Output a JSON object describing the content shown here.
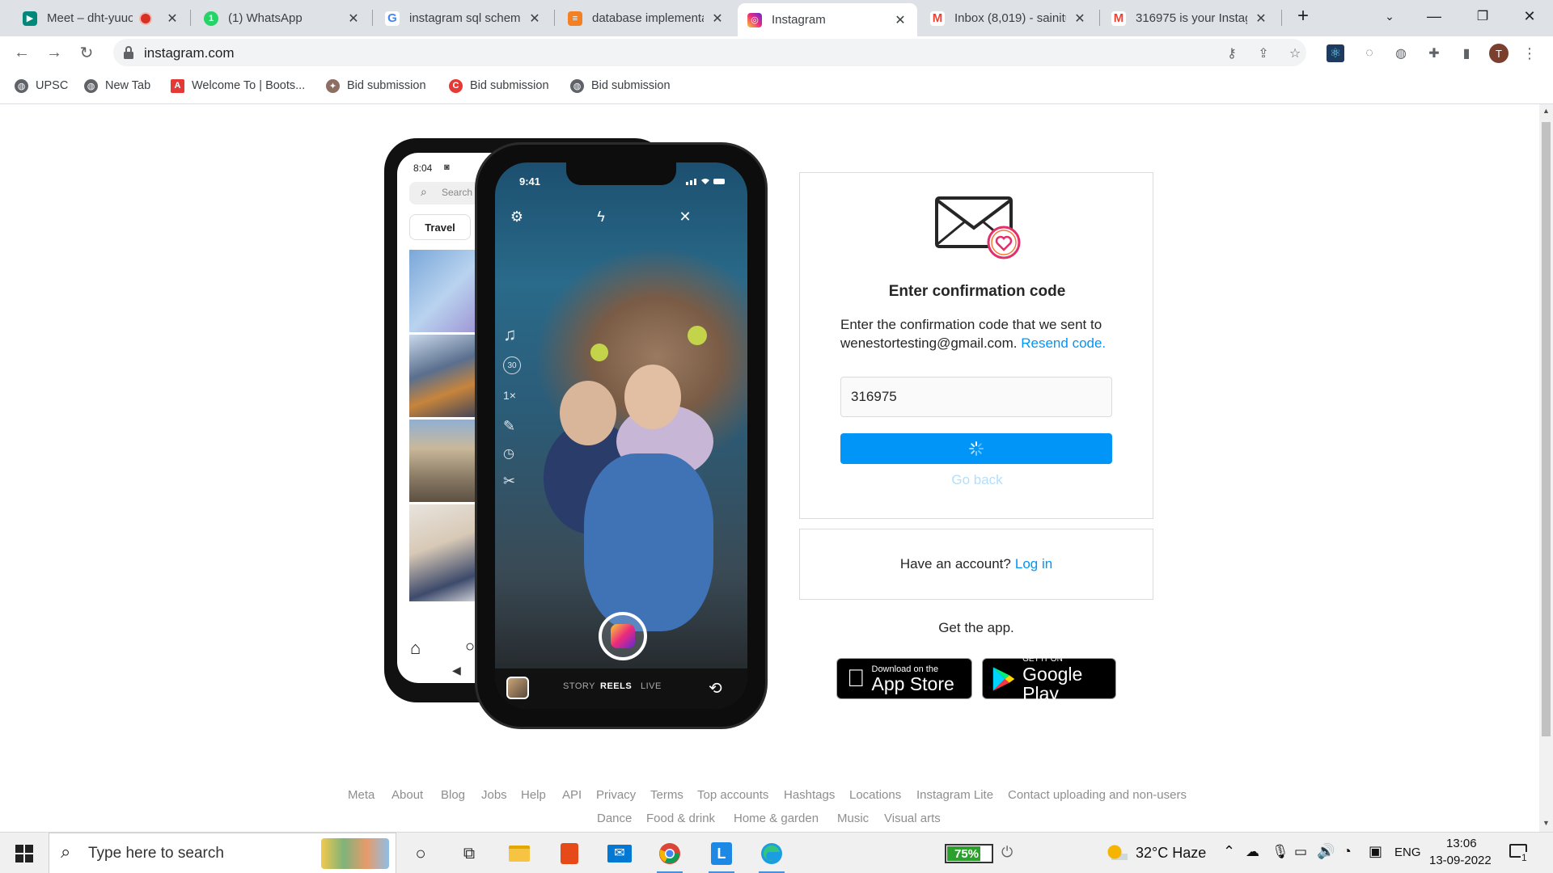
{
  "tabs": [
    {
      "title": "Meet – dht-yuuo",
      "recording": true,
      "favicon": "google-meet-icon",
      "color": "#00897b"
    },
    {
      "title": "(1) WhatsApp",
      "favicon": "whatsapp-icon",
      "color": "#25d366"
    },
    {
      "title": "instagram sql schema",
      "favicon": "google-icon",
      "color": "#4285f4"
    },
    {
      "title": "database implementa",
      "favicon": "stackoverflow-icon",
      "color": "#f48024"
    },
    {
      "title": "Instagram",
      "favicon": "instagram-icon",
      "color": "#e1306c",
      "active": true
    },
    {
      "title": "Inbox (8,019) - sainitu",
      "favicon": "gmail-icon",
      "color": "#ea4335"
    },
    {
      "title": "316975 is your Instag",
      "favicon": "gmail-icon",
      "color": "#ea4335"
    }
  ],
  "address_bar": {
    "url": "instagram.com"
  },
  "bookmarks": [
    {
      "label": "UPSC",
      "icon": "globe-icon",
      "color": "#5f6368"
    },
    {
      "label": "New Tab",
      "icon": "globe-icon",
      "color": "#5f6368"
    },
    {
      "label": "Welcome To | Boots...",
      "icon": "adobe-icon",
      "color": "#e53935"
    },
    {
      "label": "Bid submission",
      "icon": "emblem-icon",
      "color": "#8d6e63"
    },
    {
      "label": "Bid submission",
      "icon": "swirl-icon",
      "color": "#e53935"
    },
    {
      "label": "Bid submission",
      "icon": "globe-icon",
      "color": "#5f6368"
    }
  ],
  "phones": {
    "back_time": "8:04",
    "back_search": "Search",
    "back_chip": "Travel",
    "front_time": "9:41",
    "modes": [
      "STORY",
      "REELS",
      "LIVE"
    ],
    "side_labels": [
      "30",
      "1×"
    ]
  },
  "confirm": {
    "heading": "Enter confirmation code",
    "desc_prefix": "Enter the confirmation code that we sent to wenestortesting@gmail.com.",
    "resend": "Resend code.",
    "code_value": "316975",
    "go_back": "Go back"
  },
  "login_card": {
    "prompt": "Have an account?",
    "link": "Log in"
  },
  "get_app": "Get the app.",
  "badges": {
    "apple_small": "Download on the",
    "apple_big": "App Store",
    "google_small": "GET IT ON",
    "google_big": "Google Play"
  },
  "footer_row1": [
    "Meta",
    "About",
    "Blog",
    "Jobs",
    "Help",
    "API",
    "Privacy",
    "Terms",
    "Top accounts",
    "Hashtags",
    "Locations",
    "Instagram Lite",
    "Contact uploading and non-users"
  ],
  "footer_row2": [
    "Dance",
    "Food & drink",
    "Home & garden",
    "Music",
    "Visual arts"
  ],
  "taskbar": {
    "search_placeholder": "Type here to search",
    "battery": "75%",
    "weather": "32°C  Haze",
    "lang": "ENG",
    "time": "13:06",
    "date": "13-09-2022",
    "notifications": "1"
  },
  "colors": {
    "accent": "#0095f6",
    "accent_disabled": "#b2dffc"
  }
}
